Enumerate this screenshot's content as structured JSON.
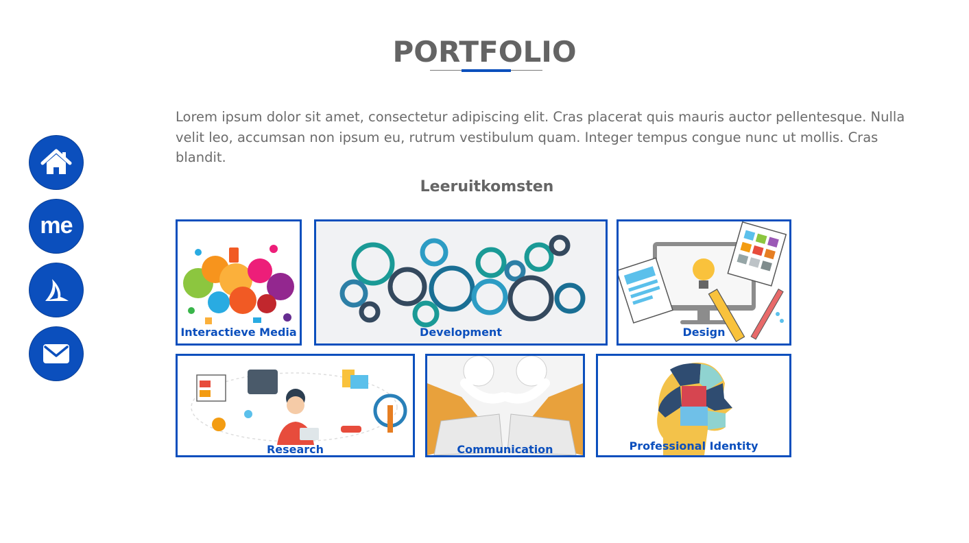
{
  "nav": {
    "items": [
      {
        "name": "home",
        "icon": "home-icon"
      },
      {
        "name": "about-me",
        "icon": "me-icon",
        "label": "me"
      },
      {
        "name": "portfolio",
        "icon": "sail-logo-icon"
      },
      {
        "name": "contact",
        "icon": "mail-icon"
      }
    ]
  },
  "page": {
    "title": "PORTFOLIO",
    "intro": "Lorem ipsum dolor sit amet, consectetur adipiscing elit. Cras placerat quis mauris auctor pellentesque. Nulla velit leo, accumsan non ipsum eu, rutrum vestibulum quam. Integer tempus congue nunc ut mollis. Cras blandit.",
    "subheading": "Leeruitkomsten"
  },
  "tiles": [
    {
      "label": "Interactieve Media"
    },
    {
      "label": "Development"
    },
    {
      "label": "Design"
    },
    {
      "label": "Research"
    },
    {
      "label": "Communication"
    },
    {
      "label": "Professional Identity"
    }
  ],
  "colors": {
    "accent": "#0b4fbd",
    "text": "#666666",
    "background": "#ffffff"
  }
}
